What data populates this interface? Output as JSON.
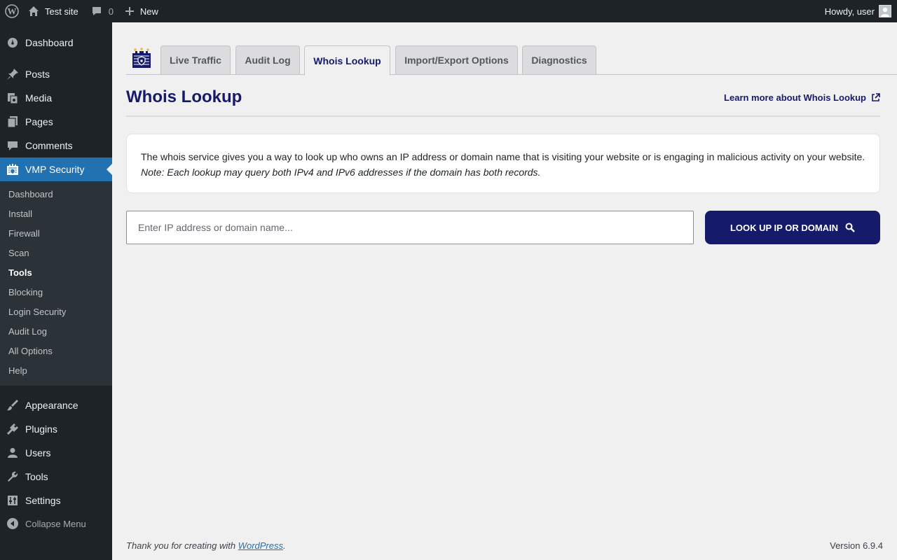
{
  "admin_bar": {
    "site_name": "Test site",
    "comments_count": "0",
    "new_label": "New",
    "greeting": "Howdy, user"
  },
  "sidebar": {
    "top_items": [
      {
        "label": "Dashboard",
        "icon": "dashboard-icon"
      },
      {
        "label": "Posts",
        "icon": "pushpin-icon"
      },
      {
        "label": "Media",
        "icon": "media-icon"
      },
      {
        "label": "Pages",
        "icon": "pages-icon"
      },
      {
        "label": "Comments",
        "icon": "comment-icon"
      },
      {
        "label": "VMP Security",
        "icon": "castle-icon"
      }
    ],
    "submenu": [
      "Dashboard",
      "Install",
      "Firewall",
      "Scan",
      "Tools",
      "Blocking",
      "Login Security",
      "Audit Log",
      "All Options",
      "Help"
    ],
    "active_submenu": "Tools",
    "bottom_items": [
      {
        "label": "Appearance",
        "icon": "paintbrush-icon"
      },
      {
        "label": "Plugins",
        "icon": "plugin-icon"
      },
      {
        "label": "Users",
        "icon": "users-icon"
      },
      {
        "label": "Tools",
        "icon": "wrench-icon"
      },
      {
        "label": "Settings",
        "icon": "settings-icon"
      }
    ],
    "collapse_label": "Collapse Menu"
  },
  "tabs": [
    {
      "label": "Live Traffic"
    },
    {
      "label": "Audit Log"
    },
    {
      "label": "Whois Lookup",
      "active": true
    },
    {
      "label": "Import/Export Options"
    },
    {
      "label": "Diagnostics"
    }
  ],
  "main": {
    "title": "Whois Lookup",
    "learn_more": "Learn more about Whois Lookup",
    "description": "The whois service gives you a way to look up who owns an IP address or domain name that is visiting your website or is engaging in malicious activity on your website.",
    "note": "Note: Each lookup may query both IPv4 and IPv6 addresses if the domain has both records.",
    "input_placeholder": "Enter IP address or domain name...",
    "input_value": "",
    "button_label": "LOOK UP IP OR DOMAIN"
  },
  "footer": {
    "thanks_prefix": "Thank you for creating with ",
    "link_text": "WordPress",
    "thanks_suffix": ".",
    "version": "Version 6.9.4"
  },
  "colors": {
    "brand_navy": "#151a6a",
    "admin_dark": "#1d2327",
    "submenu_bg": "#2c3338",
    "wp_blue": "#2271b1",
    "page_bg": "#f0f0f1"
  }
}
